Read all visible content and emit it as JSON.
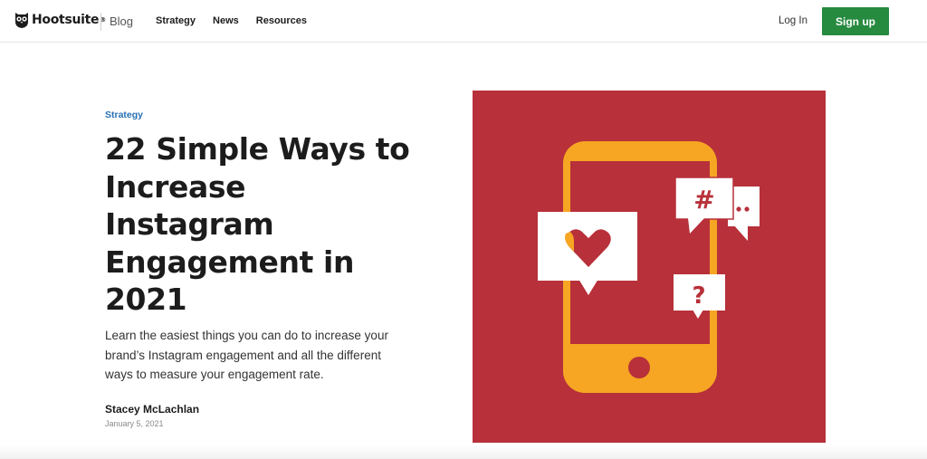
{
  "header": {
    "logo_text": "Hootsuite",
    "logo_reg": "®",
    "section": "Blog",
    "nav": [
      "Strategy",
      "News",
      "Resources"
    ],
    "login_label": "Log In",
    "signup_label": "Sign up"
  },
  "article": {
    "category": "Strategy",
    "title": "22 Simple Ways to Increase Instagram Engagement in 2021",
    "subtitle": "Learn the easiest things you can do to increase your brand’s Instagram engagement and all the different ways to measure your engagement rate.",
    "author": "Stacey McLachlan",
    "date": "January 5, 2021"
  },
  "hero": {
    "background": "#b7303a",
    "phone_color": "#f6a623",
    "bubble_color": "#ffffff",
    "hashtag_glyph": "#",
    "question_glyph": "?",
    "icons": [
      "smartphone-icon",
      "heart-icon",
      "hashtag-icon",
      "question-icon",
      "ellipsis-icon"
    ]
  },
  "colors": {
    "accent_link": "#2970b5",
    "signup_green": "#268a3f"
  }
}
